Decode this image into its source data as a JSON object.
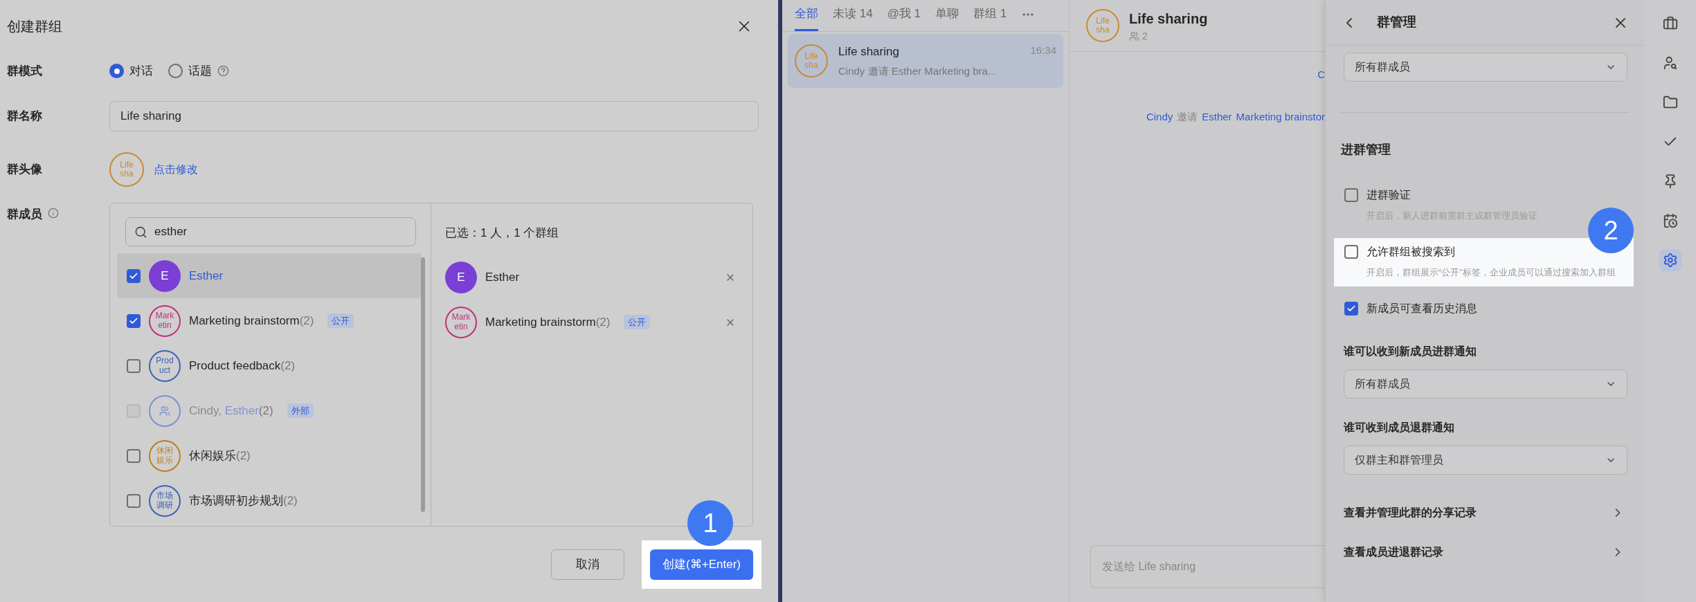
{
  "create_group_dialog": {
    "title": "创建群组",
    "mode": {
      "label": "群模式",
      "options": [
        {
          "label": "对话",
          "selected": true
        },
        {
          "label": "话题",
          "selected": false
        }
      ]
    },
    "name": {
      "label": "群名称",
      "value": "Life sharing"
    },
    "avatar": {
      "label": "群头像",
      "lines": [
        "Life",
        "sha"
      ],
      "color": "#c98a35",
      "edit_link": "点击修改"
    },
    "members": {
      "label": "群成员",
      "search": {
        "value": "esther"
      },
      "results": [
        {
          "name": [
            {
              "text": "Esther",
              "match": true
            }
          ],
          "checked": true,
          "disabled": false,
          "highlighted": true,
          "avatar": {
            "kind": "letter",
            "letter": "E",
            "color": "#7b3fd6"
          }
        },
        {
          "name": [
            {
              "text": "Marketing brainstorm",
              "match": false
            }
          ],
          "count": "(2)",
          "tag": "公开",
          "checked": true,
          "disabled": false,
          "highlighted": false,
          "avatar": {
            "kind": "text",
            "lines": [
              "Mark",
              "etin"
            ],
            "color": "#c2307a"
          }
        },
        {
          "name": [
            {
              "text": "Product feedback",
              "match": false
            }
          ],
          "count": "(2)",
          "checked": false,
          "disabled": false,
          "highlighted": false,
          "avatar": {
            "kind": "text",
            "lines": [
              "Prod",
              "uct"
            ],
            "color": "#3d62b8"
          }
        },
        {
          "name": [
            {
              "text": "Cindy, ",
              "match": false
            },
            {
              "text": "Esther",
              "match": true
            }
          ],
          "count": "(2)",
          "tag": "外部",
          "checked": false,
          "disabled": true,
          "highlighted": false,
          "avatar": {
            "kind": "group-icon",
            "color": "#7a92d0"
          }
        },
        {
          "name": [
            {
              "text": "休闲娱乐",
              "match": false
            }
          ],
          "count": "(2)",
          "checked": false,
          "disabled": false,
          "highlighted": false,
          "avatar": {
            "kind": "text",
            "lines": [
              "休闲",
              "娱乐"
            ],
            "color": "#c07d1c"
          }
        },
        {
          "name": [
            {
              "text": "市场调研初步规划",
              "match": false
            }
          ],
          "count": "(2)",
          "checked": false,
          "disabled": false,
          "highlighted": false,
          "avatar": {
            "kind": "text",
            "lines": [
              "市场",
              "调研"
            ],
            "color": "#3d62b8"
          }
        }
      ],
      "selected_summary": "已选：1 人，1 个群组",
      "selected_items": [
        {
          "name": "Esther",
          "avatar": {
            "kind": "letter",
            "letter": "E",
            "color": "#7b3fd6"
          }
        },
        {
          "name": "Marketing brainstorm",
          "count": "(2)",
          "tag": "公开",
          "avatar": {
            "kind": "text",
            "lines": [
              "Mark",
              "etin"
            ],
            "color": "#c2307a"
          }
        }
      ]
    },
    "buttons": [
      {
        "label": "取消",
        "kind": "secondary",
        "highlighted": false
      },
      {
        "label": "创建(⌘+Enter)",
        "kind": "primary",
        "highlighted": true,
        "step": "1"
      }
    ]
  },
  "chat_list": {
    "tabs": [
      {
        "label": "全部",
        "selected": true
      },
      {
        "label": "未读 14",
        "selected": false
      },
      {
        "label": "@我 1",
        "selected": false
      },
      {
        "label": "单聊",
        "selected": false
      },
      {
        "label": "群组 1",
        "selected": false
      }
    ],
    "chats": [
      {
        "title": "Life sharing",
        "time": "16:34",
        "preview": "Cindy 邀请 Esther Marketing bra...",
        "lines": [
          "Life",
          "sha"
        ],
        "color": "#c98a35",
        "selected": true
      }
    ]
  },
  "chat": {
    "title": "Life sharing",
    "lines": [
      "Life",
      "sha"
    ],
    "color": "#c98a35",
    "member_count": "2",
    "messages": [
      [
        {
          "text": "C",
          "link": true
        }
      ],
      [
        {
          "text": "Cindy",
          "link": true
        },
        {
          "text": "邀请",
          "link": false
        },
        {
          "text": "Esther",
          "link": true
        },
        {
          "text": "Marketing brainstor",
          "link": true
        }
      ]
    ],
    "composer": {
      "placeholder": "发送给 Life sharing"
    }
  },
  "group_settings": {
    "title": "群管理",
    "top_select": {
      "value": "所有群成员"
    },
    "section_title": "进群管理",
    "options": [
      {
        "label": "进群验证",
        "description": "开启后，新人进群前需群主或群管理员验证",
        "checked": false,
        "highlighted": false
      },
      {
        "label": "允许群组被搜索到",
        "description": "开启后，群组展示“公开”标签，企业成员可以通过搜索加入群组",
        "checked": false,
        "highlighted": true,
        "step": "2"
      },
      {
        "label": "新成员可查看历史消息",
        "checked": true,
        "highlighted": false
      }
    ],
    "selects": [
      {
        "label": "谁可以收到新成员进群通知",
        "value": "所有群成员"
      },
      {
        "label": "谁可收到成员退群通知",
        "value": "仅群主和群管理员"
      }
    ],
    "links": [
      "查看并管理此群的分享记录",
      "查看成员进退群记录"
    ]
  },
  "rail": [
    {
      "kind": "briefcase",
      "selected": false
    },
    {
      "kind": "user-search",
      "selected": false
    },
    {
      "kind": "folder",
      "selected": false
    },
    {
      "kind": "check",
      "selected": false
    },
    {
      "kind": "pin",
      "selected": false
    },
    {
      "kind": "calendar-clock",
      "selected": false
    },
    {
      "kind": "settings",
      "selected": true
    }
  ]
}
